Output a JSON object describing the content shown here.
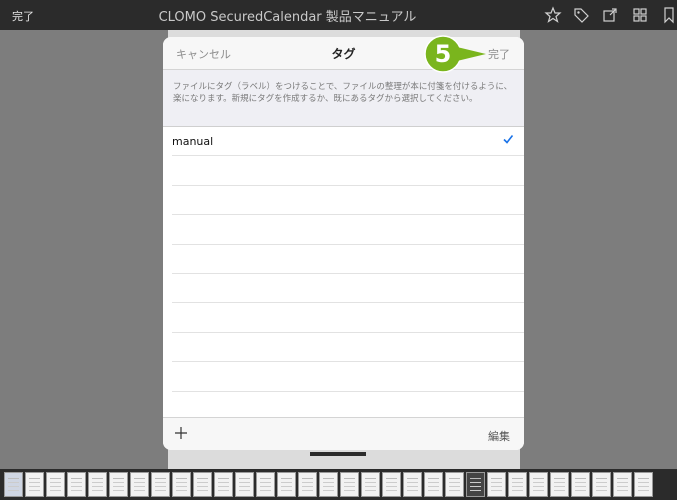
{
  "toolbar": {
    "done_label": "完了",
    "title": "CLOMO SecuredCalendar 製品マニュアル",
    "icons": [
      "star-icon",
      "tag-icon",
      "share-icon",
      "grid-icon",
      "bookmark-icon"
    ]
  },
  "modal": {
    "cancel_label": "キャンセル",
    "title": "タグ",
    "done_label": "完了",
    "description": "ファイルにタグ（ラベル）をつけることで、ファイルの整理が本に付箋を付けるように、楽になります。新規にタグを作成するか、既にあるタグから選択してください。",
    "tags": [
      {
        "label": "manual",
        "checked": true
      }
    ],
    "edit_label": "編集"
  },
  "callout": {
    "step": "5",
    "color": "#7ab51d"
  },
  "colors": {
    "check": "#1a73e8",
    "toolbar": "#2b2b2b"
  }
}
